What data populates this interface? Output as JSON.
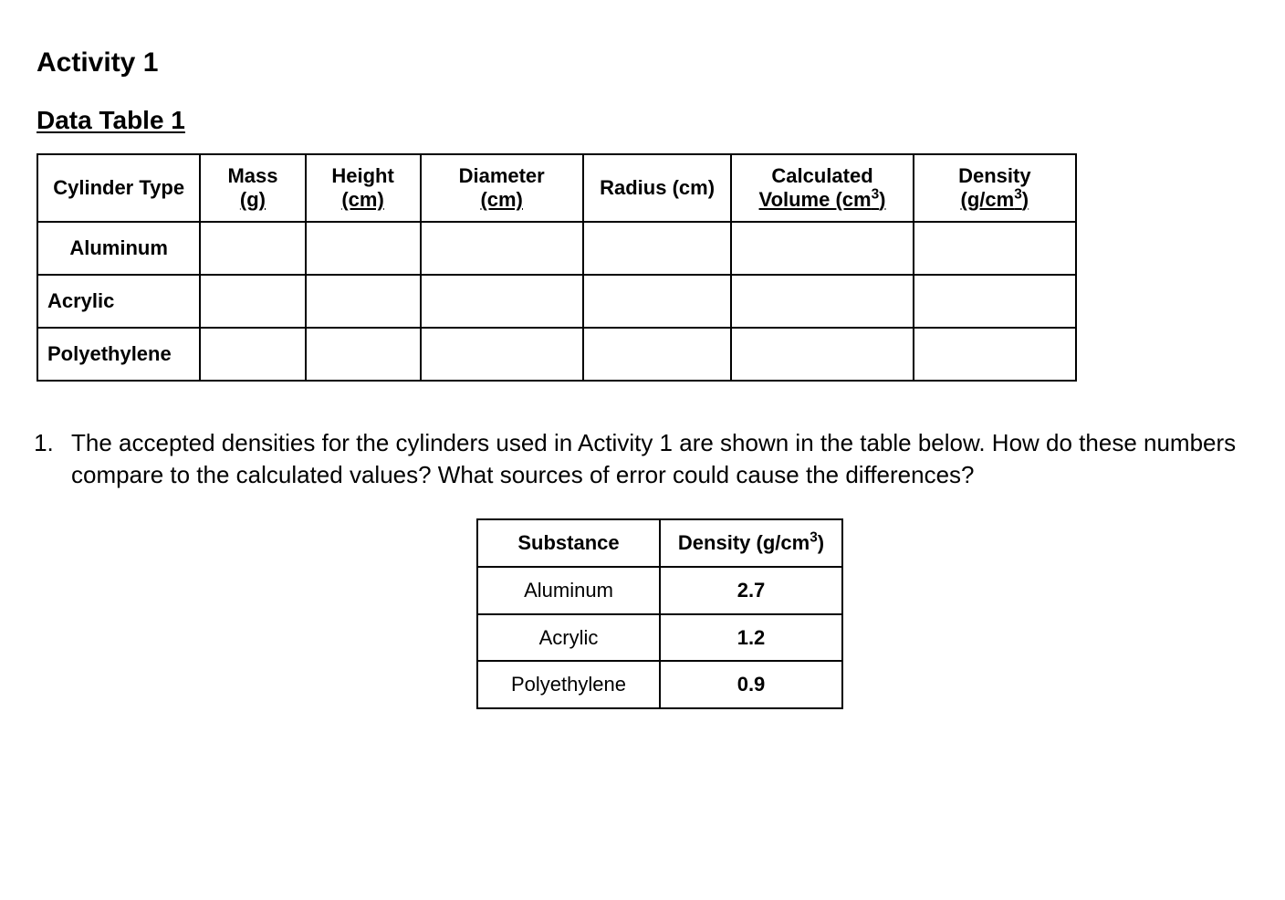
{
  "headings": {
    "activity": "Activity 1",
    "table_caption": "Data Table 1"
  },
  "data_table": {
    "headers": {
      "type": "Cylinder Type",
      "mass_label": "Mass",
      "mass_unit": "(g)",
      "height_label": "Height",
      "height_unit": "(cm)",
      "diameter_label": "Diameter",
      "diameter_unit": "(cm)",
      "radius": "Radius (cm)",
      "volume_label": "Calculated",
      "volume_unit_pre": "Volume (cm",
      "volume_unit_sup": "3",
      "volume_unit_post": ")",
      "density_label": "Density",
      "density_unit_pre": "(g/cm",
      "density_unit_sup": "3",
      "density_unit_post": ")"
    },
    "rows": [
      {
        "type": "Aluminum",
        "mass": "",
        "height": "",
        "diameter": "",
        "radius": "",
        "volume": "",
        "density": ""
      },
      {
        "type": "Acrylic",
        "mass": "",
        "height": "",
        "diameter": "",
        "radius": "",
        "volume": "",
        "density": ""
      },
      {
        "type": "Polyethylene",
        "mass": "",
        "height": "",
        "diameter": "",
        "radius": "",
        "volume": "",
        "density": ""
      }
    ]
  },
  "question": {
    "number": "1.",
    "text": "The accepted densities for the cylinders used in Activity 1 are shown in the table below. How do these numbers compare to the calculated values? What sources of error could cause the differences?"
  },
  "density_table": {
    "headers": {
      "substance": "Substance",
      "density_pre": "Density (g/cm",
      "density_sup": "3",
      "density_post": ")"
    },
    "rows": [
      {
        "substance": "Aluminum",
        "density": "2.7"
      },
      {
        "substance": "Acrylic",
        "density": "1.2"
      },
      {
        "substance": "Polyethylene",
        "density": "0.9"
      }
    ]
  }
}
